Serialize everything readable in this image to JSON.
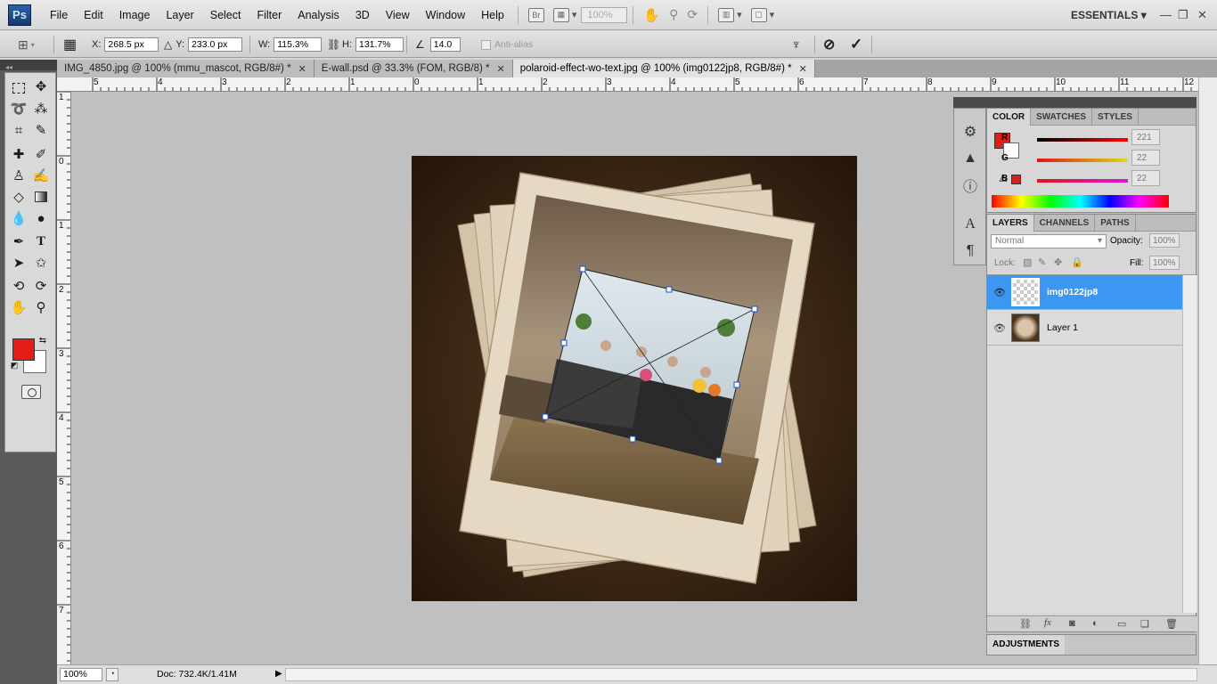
{
  "app": {
    "logo": "Ps",
    "workspace": "ESSENTIALS"
  },
  "menu": [
    "File",
    "Edit",
    "Image",
    "Layer",
    "Select",
    "Filter",
    "Analysis",
    "3D",
    "View",
    "Window",
    "Help"
  ],
  "menubar": {
    "bridge_label": "Br",
    "zoom_value": "100%"
  },
  "options": {
    "x_label": "X:",
    "x_value": "268.5 px",
    "y_label": "Y:",
    "y_value": "233.0 px",
    "w_label": "W:",
    "w_value": "115.3%",
    "h_label": "H:",
    "h_value": "131.7%",
    "angle_value": "14.0",
    "antialias_label": "Anti-alias"
  },
  "tabs": [
    {
      "label": "IMG_4850.jpg @ 100% (mmu_mascot, RGB/8#) *",
      "active": false
    },
    {
      "label": "E-wall.psd @ 33.3% (FOM, RGB/8) *",
      "active": false
    },
    {
      "label": "polaroid-effect-wo-text.jpg @ 100% (img0122jp8, RGB/8#) *",
      "active": true
    }
  ],
  "ruler": {
    "top_labels": [
      "5",
      "4",
      "3",
      "2",
      "1",
      "0",
      "1",
      "2",
      "3",
      "4",
      "5",
      "6",
      "7",
      "8",
      "9",
      "10",
      "11",
      "12"
    ],
    "left_labels": [
      "1",
      "0",
      "1",
      "2",
      "3",
      "4",
      "5",
      "6",
      "7"
    ]
  },
  "status": {
    "zoom": "100%",
    "doc": "Doc: 732.4K/1.41M"
  },
  "colors": {
    "foreground": "#e31e18",
    "background": "#ffffff",
    "selection": "#3c97f3"
  },
  "color_panel": {
    "tabs": [
      "COLOR",
      "SWATCHES",
      "STYLES"
    ],
    "channels": [
      {
        "name": "R",
        "value": "221"
      },
      {
        "name": "G",
        "value": "22"
      },
      {
        "name": "B",
        "value": "22"
      }
    ]
  },
  "layers_panel": {
    "tabs": [
      "LAYERS",
      "CHANNELS",
      "PATHS"
    ],
    "blend_mode": "Normal",
    "opacity_label": "Opacity:",
    "opacity_value": "100%",
    "lock_label": "Lock:",
    "fill_label": "Fill:",
    "fill_value": "100%",
    "layers": [
      {
        "name": "img0122jp8",
        "selected": true
      },
      {
        "name": "Layer 1",
        "selected": false
      }
    ]
  },
  "adjustments": {
    "label": "ADJUSTMENTS"
  }
}
